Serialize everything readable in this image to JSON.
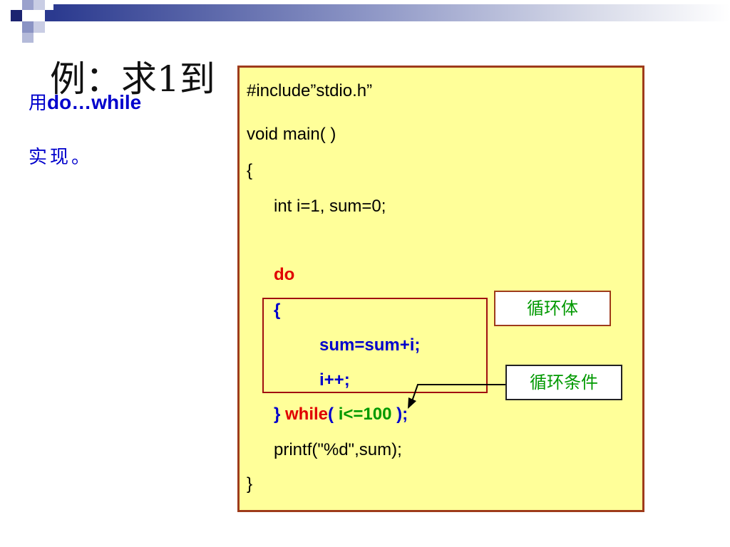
{
  "title": "例：求1到",
  "description": {
    "prefix": "用",
    "keyword": "do…while",
    "line2": "实现。"
  },
  "code": {
    "include": "#include”stdio.h”",
    "main": "void main( )",
    "open_brace": "{",
    "decl": "int i=1,  sum=0;",
    "do_kw": "do",
    "body_open": "{",
    "stmt1": "sum=sum+i;",
    "stmt2": "i++;",
    "close_part": "}",
    "while_kw": "while",
    "paren_open": "(",
    "condition": " i<=100 ",
    "paren_close": ");",
    "printf": "printf(\"%d\",sum);",
    "close_brace": "}"
  },
  "annotations": {
    "loop_body": "循环体",
    "loop_condition": "循环条件"
  },
  "colors": {
    "panel_bg": "#ffff99",
    "panel_border": "#9e3b1b",
    "keyword_red": "#e00000",
    "code_blue": "#0000cc",
    "condition_green": "#009900"
  }
}
